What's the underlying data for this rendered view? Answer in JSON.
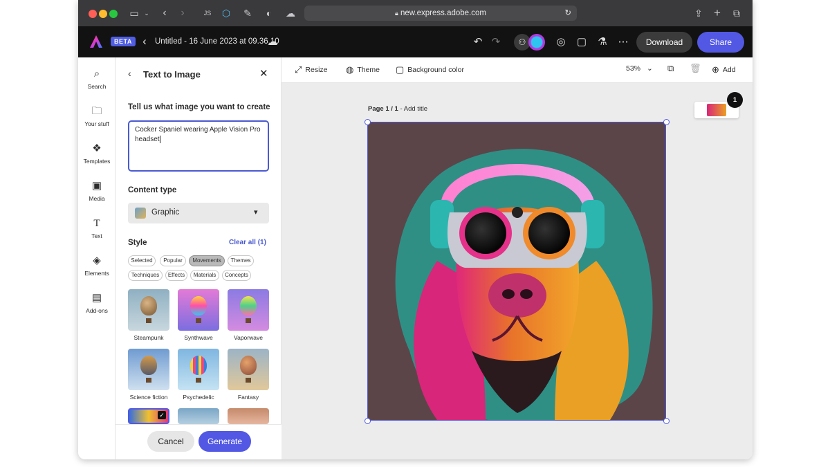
{
  "browser": {
    "url": "new.express.adobe.com",
    "colors": {
      "close": "#ff5f57",
      "minimize": "#febc2e",
      "zoom": "#28c840"
    }
  },
  "appbar": {
    "beta": "BETA",
    "doc_title": "Untitled - 16 June 2023 at 09.36.10",
    "download": "Download",
    "share": "Share"
  },
  "rail": [
    {
      "label": "Search",
      "icon": "search-icon"
    },
    {
      "label": "Your stuff",
      "icon": "folder-icon"
    },
    {
      "label": "Templates",
      "icon": "templates-icon"
    },
    {
      "label": "Media",
      "icon": "media-icon"
    },
    {
      "label": "Text",
      "icon": "text-icon"
    },
    {
      "label": "Elements",
      "icon": "elements-icon"
    },
    {
      "label": "Add-ons",
      "icon": "addons-icon"
    }
  ],
  "panel": {
    "title": "Text to Image",
    "prompt_label": "Tell us what image you want to create",
    "prompt_value": "Cocker Spaniel wearing Apple Vision Pro headset",
    "content_type_label": "Content type",
    "content_type_value": "Graphic",
    "style_label": "Style",
    "clear_all": "Clear all (1)",
    "chips": [
      "Selected",
      "Popular",
      "Movements",
      "Themes",
      "Techniques",
      "Effects",
      "Materials",
      "Concepts"
    ],
    "selected_chip": "Movements",
    "tiles": [
      "Steampunk",
      "Synthwave",
      "Vaporwave",
      "Science fiction",
      "Psychedelic",
      "Fantasy"
    ],
    "cancel": "Cancel",
    "generate": "Generate"
  },
  "canvas_toolbar": {
    "resize": "Resize",
    "theme": "Theme",
    "background": "Background color",
    "zoom": "53%",
    "add": "Add"
  },
  "canvas": {
    "page_label_bold": "Page 1 / 1",
    "page_label_rest": " - Add title",
    "page_count_badge": "1"
  }
}
